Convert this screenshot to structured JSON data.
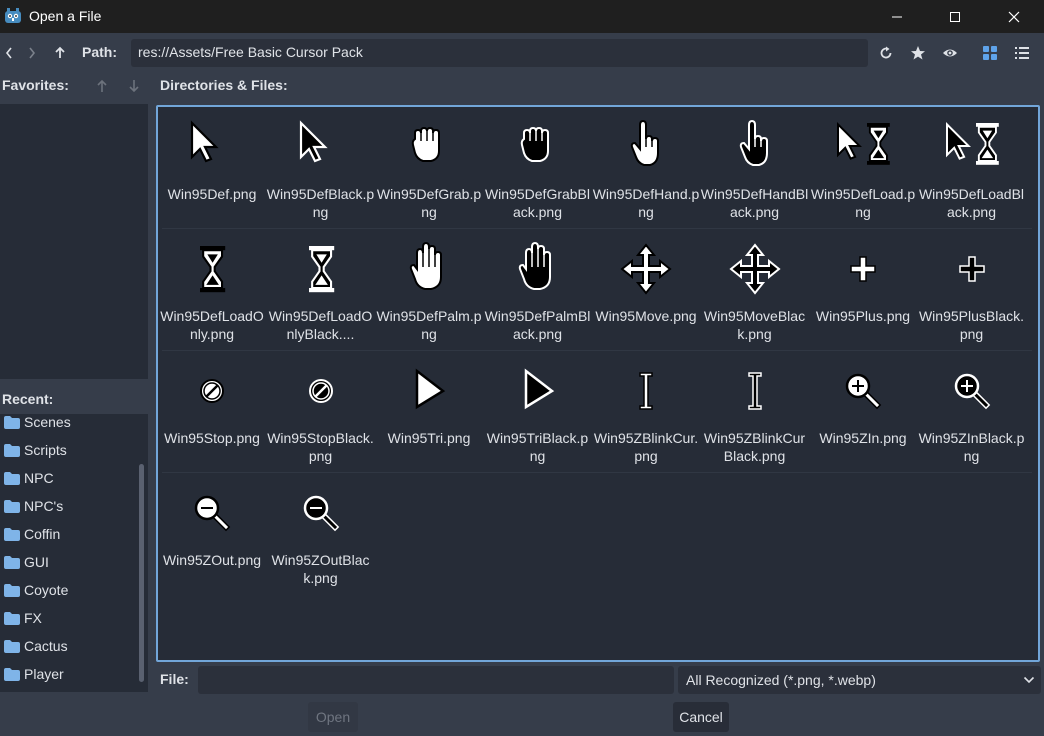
{
  "window": {
    "title": "Open a File"
  },
  "toolbar": {
    "path_label": "Path:",
    "path_value": "res://Assets/Free Basic Cursor Pack"
  },
  "favorites": {
    "header": "Favorites:"
  },
  "recent": {
    "header": "Recent:",
    "items": [
      "Scenes",
      "Scripts",
      "NPC",
      "NPC's",
      "Coffin",
      "GUI",
      "Coyote",
      "FX",
      "Cactus",
      "Player"
    ]
  },
  "files": {
    "header": "Directories & Files:",
    "items": [
      {
        "name": "Win95Def.png",
        "icon": "arrow-cursor-icon"
      },
      {
        "name": "Win95DefBlack.png",
        "icon": "arrow-cursor-black-icon"
      },
      {
        "name": "Win95DefGrab.png",
        "icon": "grab-hand-icon"
      },
      {
        "name": "Win95DefGrabBlack.png",
        "icon": "grab-hand-black-icon"
      },
      {
        "name": "Win95DefHand.png",
        "icon": "pointing-hand-icon"
      },
      {
        "name": "Win95DefHandBlack.png",
        "icon": "pointing-hand-black-icon"
      },
      {
        "name": "Win95DefLoad.png",
        "icon": "arrow-hourglass-icon"
      },
      {
        "name": "Win95DefLoadBlack.png",
        "icon": "arrow-hourglass-black-icon"
      },
      {
        "name": "Win95DefLoadOnly.png",
        "icon": "hourglass-icon"
      },
      {
        "name": "Win95DefLoadOnlyBlack....",
        "icon": "hourglass-black-icon"
      },
      {
        "name": "Win95DefPalm.png",
        "icon": "palm-icon"
      },
      {
        "name": "Win95DefPalmBlack.png",
        "icon": "palm-black-icon"
      },
      {
        "name": "Win95Move.png",
        "icon": "move-icon"
      },
      {
        "name": "Win95MoveBlack.png",
        "icon": "move-black-icon"
      },
      {
        "name": "Win95Plus.png",
        "icon": "plus-icon"
      },
      {
        "name": "Win95PlusBlack.png",
        "icon": "plus-black-icon"
      },
      {
        "name": "Win95Stop.png",
        "icon": "stop-icon"
      },
      {
        "name": "Win95StopBlack.png",
        "icon": "stop-black-icon"
      },
      {
        "name": "Win95Tri.png",
        "icon": "triangle-icon"
      },
      {
        "name": "Win95TriBlack.png",
        "icon": "triangle-black-icon"
      },
      {
        "name": "Win95ZBlinkCur.png",
        "icon": "text-cursor-icon"
      },
      {
        "name": "Win95ZBlinkCurBlack.png",
        "icon": "text-cursor-black-icon"
      },
      {
        "name": "Win95ZIn.png",
        "icon": "zoom-in-icon"
      },
      {
        "name": "Win95ZInBlack.png",
        "icon": "zoom-in-black-icon"
      },
      {
        "name": "Win95ZOut.png",
        "icon": "zoom-out-icon"
      },
      {
        "name": "Win95ZOutBlack.png",
        "icon": "zoom-out-black-icon"
      }
    ]
  },
  "footer": {
    "file_label": "File:",
    "file_value": "",
    "filter_value": "All Recognized (*.png, *.webp)",
    "open_label": "Open",
    "cancel_label": "Cancel"
  },
  "colors": {
    "accent": "#72a6d9",
    "panel": "#262c37",
    "background": "#363d4a",
    "titlebar": "#1f1f1f"
  }
}
